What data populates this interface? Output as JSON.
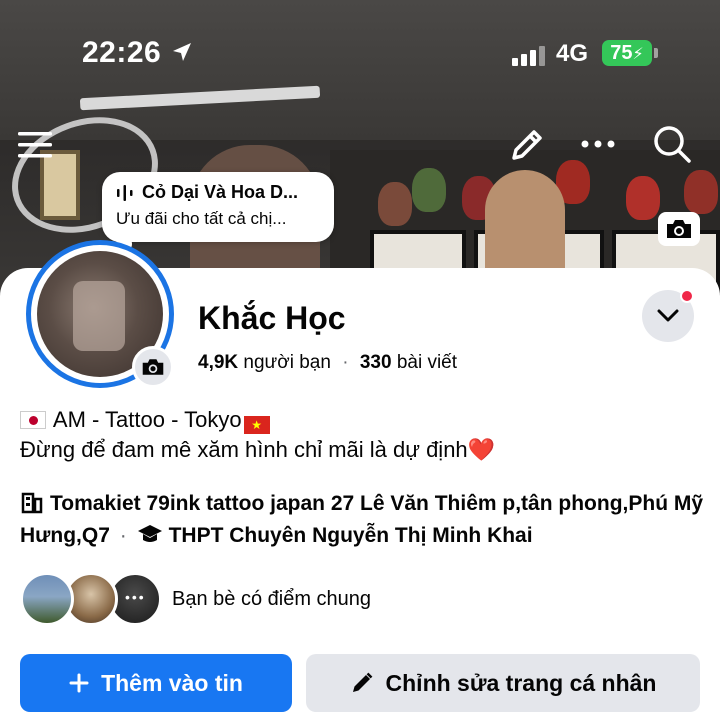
{
  "status_bar": {
    "time": "22:26",
    "network": "4G",
    "battery": "75"
  },
  "song_note": {
    "title": "Cỏ Dại Và Hoa D...",
    "subtitle": "Ưu đãi cho tất cả chị..."
  },
  "profile": {
    "name": "Khắc Học",
    "friends_count": "4,9K",
    "friends_label": "người bạn",
    "posts_count": "330",
    "posts_label": "bài viết"
  },
  "bio": {
    "line1_text": "AM - Tattoo - Tokyo",
    "line2_text": "Đừng để đam mê xăm hình chỉ mãi là dự định",
    "heart": "❤️"
  },
  "work": {
    "workplace": "Tomakiet 79ink tattoo japan 27 Lê Văn Thiêm p,tân phong,Phú Mỹ Hưng,Q7",
    "separator": "·",
    "school": "THPT Chuyên Nguyễn Thị Minh Khai"
  },
  "mutual_friends": {
    "label": "Bạn bè có điểm chung"
  },
  "buttons": {
    "add_story": "Thêm vào tin",
    "edit_profile": "Chỉnh sửa trang cá nhân"
  },
  "colors": {
    "accent": "#1877f2",
    "battery": "#34c759",
    "notification": "#f02849"
  }
}
